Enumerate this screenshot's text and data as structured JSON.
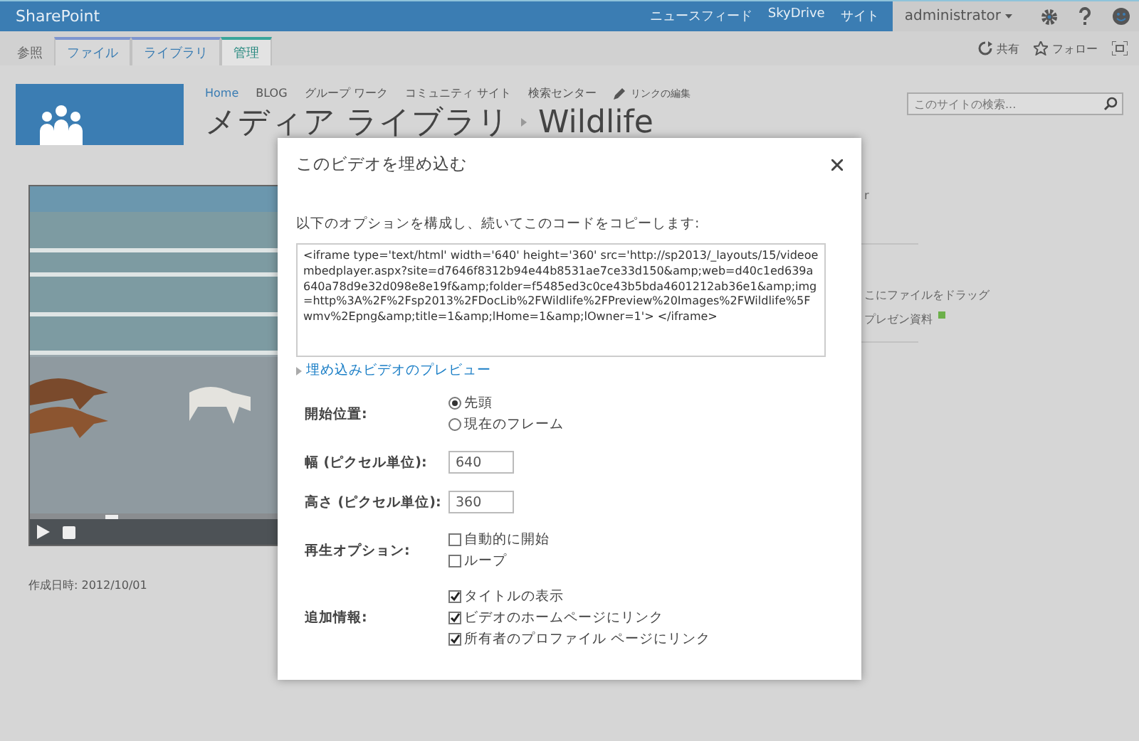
{
  "top_bar": {
    "brand": "SharePoint",
    "links": [
      "ニュースフィード",
      "SkyDrive",
      "サイト"
    ],
    "user": "administrator"
  },
  "ribbon": {
    "tabs": [
      {
        "label": "参照",
        "selected": false
      },
      {
        "label": "ファイル",
        "selected": false,
        "color": "#7f95cf"
      },
      {
        "label": "ライブラリ",
        "selected": false,
        "color": "#7f95cf"
      },
      {
        "label": "管理",
        "selected": true,
        "color": "#3aa59a"
      }
    ],
    "actions": [
      "共有",
      "フォロー"
    ]
  },
  "nav": {
    "links": [
      {
        "label": "Home",
        "selected": true
      },
      {
        "label": "BLOG",
        "selected": false
      },
      {
        "label": "グループ ワーク",
        "selected": false
      },
      {
        "label": "コミュニティ サイト",
        "selected": false
      },
      {
        "label": "検索センター",
        "selected": false
      }
    ],
    "edit_links": "リンクの編集"
  },
  "title": {
    "library": "メディア ライブラリ",
    "item": "Wildlife"
  },
  "search": {
    "placeholder": "このサイトの検索..."
  },
  "video": {
    "level": 0.3,
    "created": "作成日時: 2012/10/01"
  },
  "right_panel": {
    "texts": [
      "r",
      "こにファイルをドラッグ",
      "プレゼン資料"
    ]
  },
  "dialog": {
    "title": "このビデオを埋め込む",
    "intro": "以下のオプションを構成し、続いてこのコードをコピーします:",
    "code": "<iframe type='text/html' width='640' height='360' src='http://sp2013/_layouts/15/videoembedplayer.aspx?site=d7646f8312b94e44b8531ae7ce33d150&amp;web=d40c1ed639a640a78d9e32d098e8e19f&amp;folder=f5485ed3c0ce43b5bda4601212ab36e1&amp;img=http%3A%2F%2Fsp2013%2FDocLib%2FWildlife%2FPreview%20Images%2FWildlife%5Fwmv%2Epng&amp;title=1&amp;lHome=1&amp;lOwner=1'> </iframe>",
    "preview_link": "埋め込みビデオのプレビュー",
    "rows": [
      {
        "kind": "radio",
        "label": "開始位置:",
        "options": [
          {
            "label": "先頭",
            "selected": true
          },
          {
            "label": "現在のフレーム",
            "selected": false
          }
        ]
      },
      {
        "kind": "input",
        "label": "幅 (ピクセル単位):",
        "value": "640"
      },
      {
        "kind": "input",
        "label": "高さ (ピクセル単位):",
        "value": "360"
      },
      {
        "kind": "checkbox",
        "label": "再生オプション:",
        "options": [
          {
            "label": "自動的に開始",
            "checked": false
          },
          {
            "label": "ループ",
            "checked": false
          }
        ]
      },
      {
        "kind": "checkbox",
        "label": "追加情報:",
        "options": [
          {
            "label": "タイトルの表示",
            "checked": true
          },
          {
            "label": "ビデオのホームページにリンク",
            "checked": true
          },
          {
            "label": "所有者のプロファイル ページにリンク",
            "checked": true
          }
        ]
      }
    ]
  }
}
